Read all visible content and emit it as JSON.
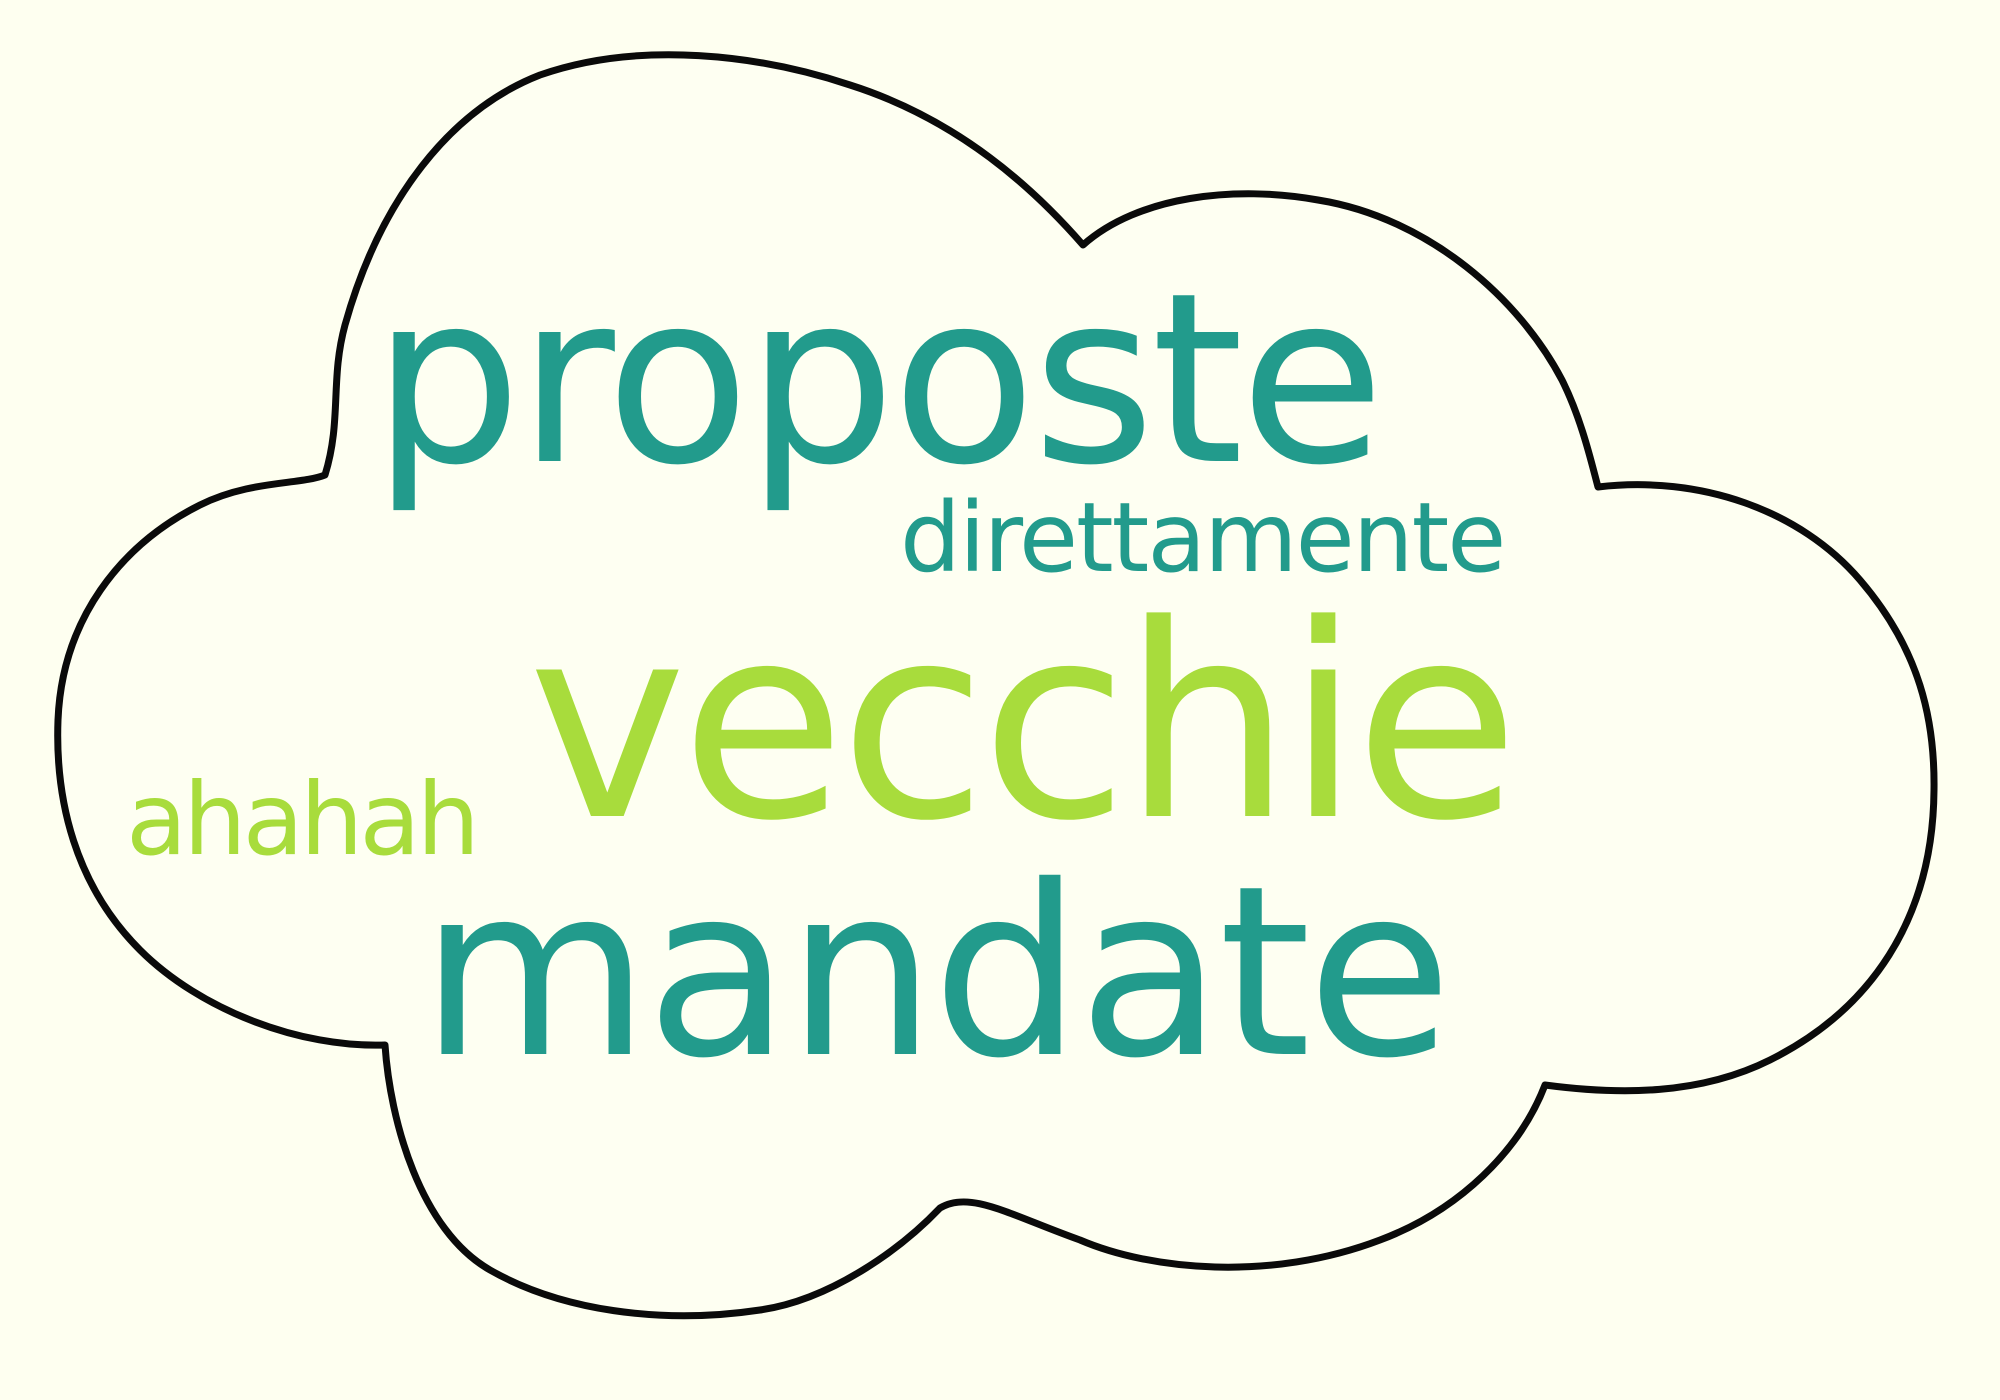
{
  "words": {
    "proposte": "proposte",
    "direttamente": "direttamente",
    "ahahah": "ahahah",
    "vecchie": "vecchie",
    "mandate": "mandate"
  },
  "colors": {
    "background": "#fefff0",
    "cloud_fill": "#fefff2",
    "cloud_stroke": "#0a0a0a",
    "teal": "#229b8c",
    "lime": "#a8dc3c"
  }
}
